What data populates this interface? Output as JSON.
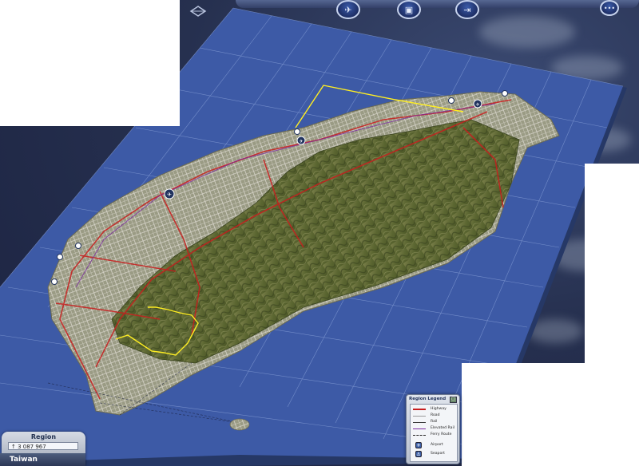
{
  "toolbar": {
    "buttons": [
      {
        "name": "region-view-icon",
        "glyph": "✈"
      },
      {
        "name": "city-tools-icon",
        "glyph": "▣"
      },
      {
        "name": "exit-region-icon",
        "glyph": "⇥"
      },
      {
        "name": "more-options-icon",
        "glyph": "•••"
      }
    ]
  },
  "region": {
    "title": "Region",
    "population": "↑ 3 087 967",
    "name": "Taiwan"
  },
  "legend": {
    "title": "Region Legend",
    "close_glyph": "□",
    "items": [
      {
        "label": "Highway",
        "color": "#c81e1e",
        "style": "solid",
        "width": 2
      },
      {
        "label": "Road",
        "color": "#9a9a9a",
        "style": "solid",
        "width": 1
      },
      {
        "label": "Rail",
        "color": "#3a3a3a",
        "style": "solid",
        "width": 1
      },
      {
        "label": "Elevated Rail",
        "color": "#7a2aa0",
        "style": "solid",
        "width": 1
      },
      {
        "label": "Ferry Route",
        "color": "#222222",
        "style": "dashed",
        "width": 1
      }
    ],
    "icons": [
      {
        "label": "Airport",
        "glyph": "✈"
      },
      {
        "label": "Seaport",
        "glyph": "⚓"
      }
    ]
  },
  "colors": {
    "water": "#3d5aa6",
    "grid": "#8aa2d8",
    "land_lowland": "#8f9470",
    "mountain": "#5d6b34",
    "highway": "#c81e1e",
    "selection": "#ffee22"
  }
}
